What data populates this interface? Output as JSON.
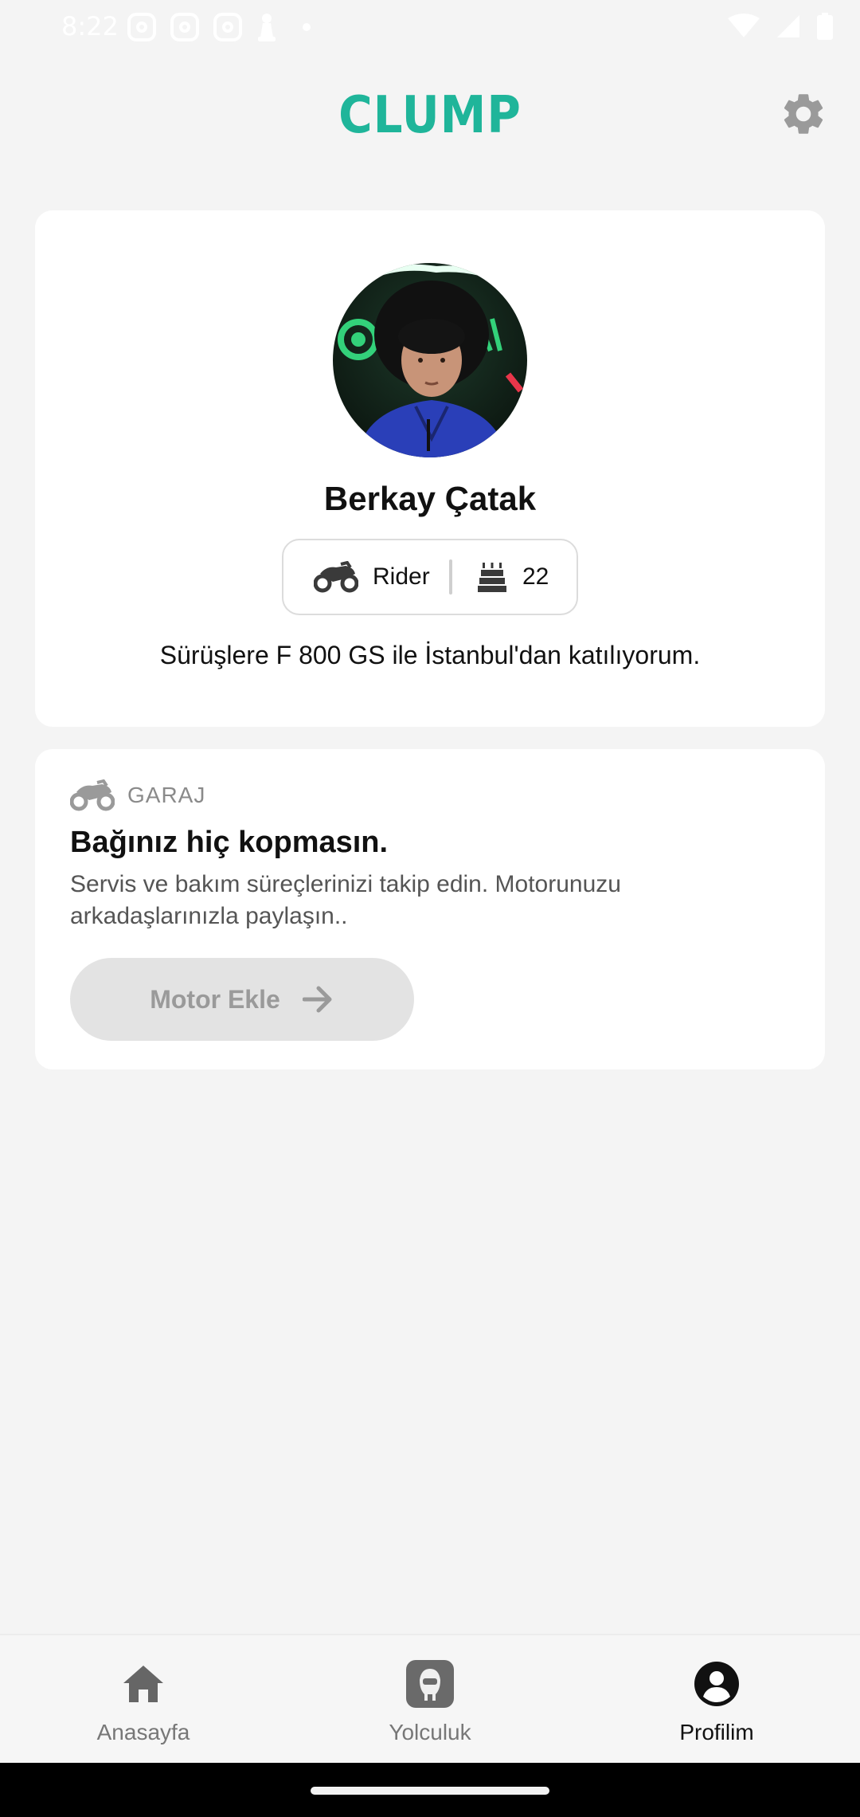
{
  "status_bar": {
    "time": "8:22",
    "left_icons": [
      "instagram-icon",
      "instagram-icon",
      "instagram-icon",
      "chess-pawn-icon",
      "dot-icon"
    ],
    "right_icons": [
      "wifi-icon",
      "signal-icon",
      "battery-icon"
    ]
  },
  "header": {
    "logo_text": "CLUMP",
    "logo_color": "#1fb59a",
    "settings_icon": "gear-icon"
  },
  "profile": {
    "name": "Berkay Çatak",
    "role_icon": "motorcycle-icon",
    "role": "Rider",
    "age_icon": "birthday-cake-icon",
    "age": "22",
    "bio": "Sürüşlere F 800 GS ile İstanbul'dan katılıyorum."
  },
  "garage": {
    "section_label": "GARAJ",
    "title": "Bağınız hiç kopmasın.",
    "description": "Servis ve bakım süreçlerinizi takip edin. Motorunuzu arkadaşlarınızla paylaşın..",
    "button_label": "Motor Ekle"
  },
  "bottom_nav": {
    "items": [
      {
        "label": "Anasayfa",
        "icon": "home-icon",
        "active": false
      },
      {
        "label": "Yolculuk",
        "icon": "helmet-icon",
        "active": false
      },
      {
        "label": "Profilim",
        "icon": "user-circle-icon",
        "active": true
      }
    ]
  }
}
